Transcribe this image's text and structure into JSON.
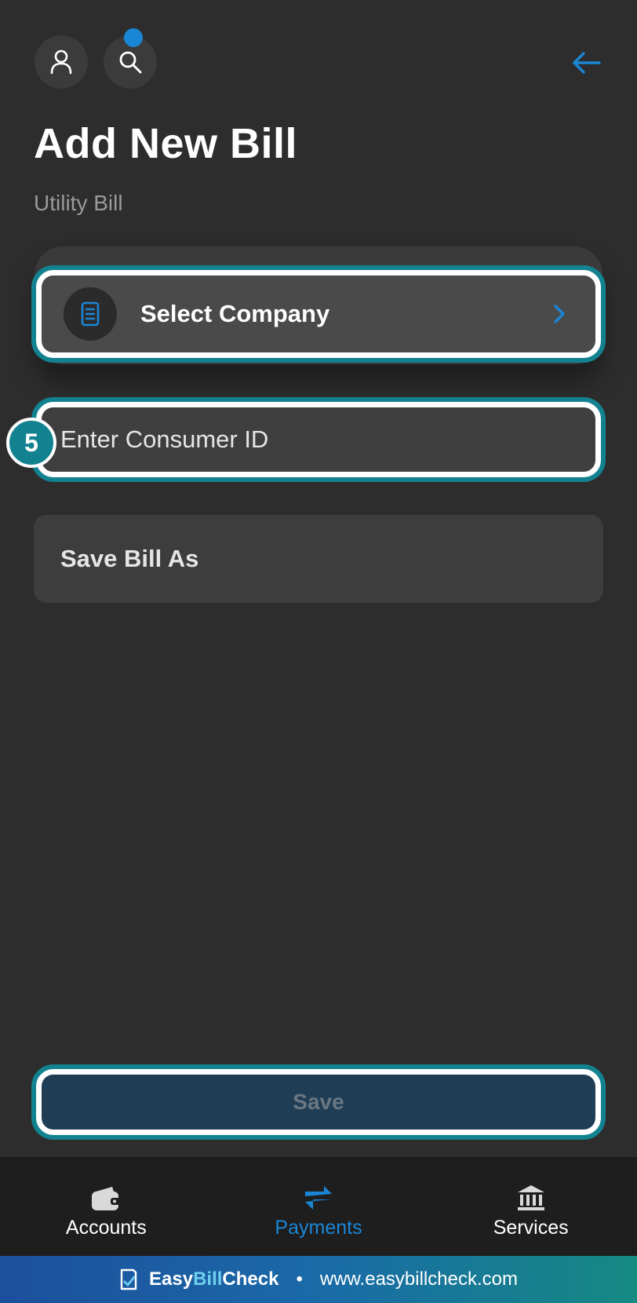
{
  "header": {
    "profile_icon": "person-icon",
    "search_icon": "search-icon",
    "back_icon": "arrow-left-icon",
    "accent": "#1a86d6"
  },
  "page": {
    "title": "Add New Bill",
    "subtitle": "Utility Bill"
  },
  "form": {
    "select_company_label": "Select Company",
    "consumer_id_placeholder": "Enter Consumer ID",
    "consumer_id_value": "",
    "save_bill_as_label": "Save Bill As",
    "save_button_label": "Save"
  },
  "annotation": {
    "step_number": "5",
    "highlight_color": "#138290"
  },
  "bottom_nav": {
    "items": [
      {
        "label": "Accounts",
        "icon": "wallet-icon",
        "active": false
      },
      {
        "label": "Payments",
        "icon": "transfer-icon",
        "active": true
      },
      {
        "label": "Services",
        "icon": "bank-icon",
        "active": false
      }
    ]
  },
  "footer": {
    "brand_part1": "Easy",
    "brand_part2": "Bill",
    "brand_part3": "Check",
    "separator": "•",
    "website": "www.easybillcheck.com"
  }
}
